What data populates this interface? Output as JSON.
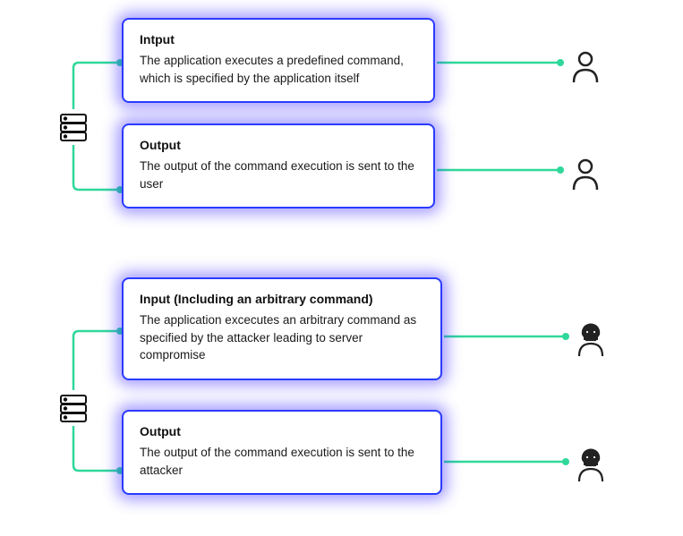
{
  "scenario1": {
    "input": {
      "title": "Intput",
      "body": "The application executes a predefined command, which is specified by the application itself"
    },
    "output": {
      "title": "Output",
      "body": "The output of the command execution is sent to the user"
    },
    "actor": "user"
  },
  "scenario2": {
    "input": {
      "title": "Input (Including an arbitrary command)",
      "body": "The application excecutes an arbitrary command as specified by the attacker leading to server compromise"
    },
    "output": {
      "title": "Output",
      "body": "The output of the command execution is sent to the attacker"
    },
    "actor": "attacker"
  },
  "colors": {
    "cardBorder": "#2a3bff",
    "flowLine": "#2fd89a",
    "iconStroke": "#111111"
  }
}
